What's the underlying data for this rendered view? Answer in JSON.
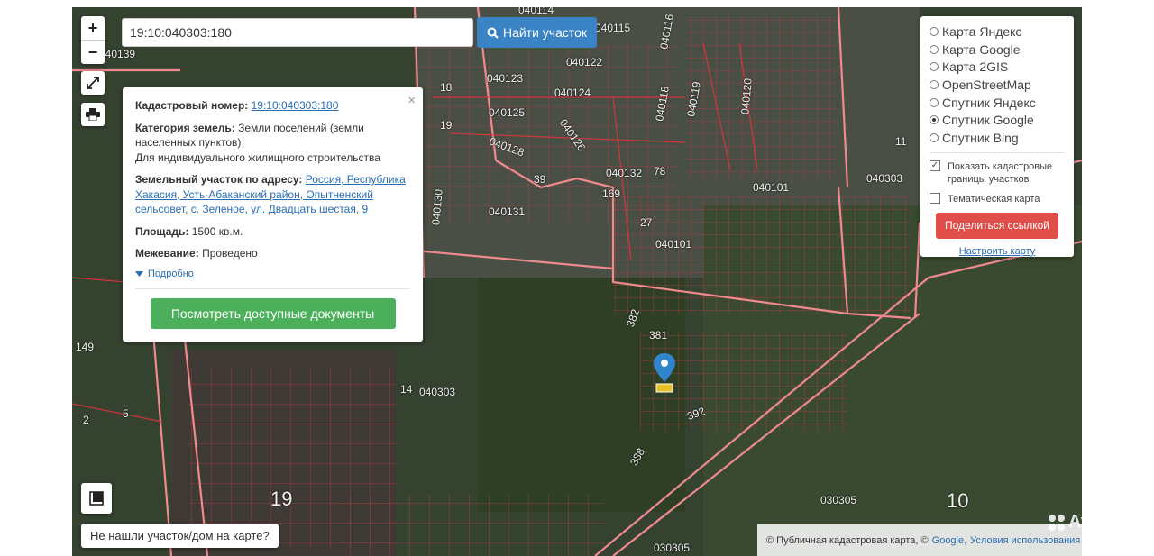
{
  "search": {
    "value": "19:10:040303:180",
    "button_label": "Найти участок"
  },
  "controls": {
    "zoom_in": "+",
    "zoom_out": "−"
  },
  "info_panel": {
    "close": "×",
    "cadastral_label": "Кадастровый номер:",
    "cadastral_value": "19:10:040303:180",
    "category_label": "Категория земель:",
    "category_value": "Земли поселений (земли населенных пунктов)",
    "usage_value": "Для индивидуального жилищного строительства",
    "address_label": "Земельный участок по адресу:",
    "address_value": "Россия, Республика Хакасия, Усть-Абаканский район, Опытненский сельсовет, с. Зеленое, ул. Двадцать шестая, 9",
    "area_label": "Площадь:",
    "area_value": "1500 кв.м.",
    "survey_label": "Межевание:",
    "survey_value": "Проведено",
    "more_link": "Подробно",
    "docs_button": "Посмотреть доступные документы"
  },
  "layers_panel": {
    "options": [
      {
        "label": "Карта Яндекс",
        "selected": false
      },
      {
        "label": "Карта Google",
        "selected": false
      },
      {
        "label": "Карта 2GIS",
        "selected": false
      },
      {
        "label": "OpenStreetMap",
        "selected": false
      },
      {
        "label": "Спутник Яндекс",
        "selected": false
      },
      {
        "label": "Спутник Google",
        "selected": true
      },
      {
        "label": "Спутник Bing",
        "selected": false
      }
    ],
    "show_borders_label": "Показать кадастровые границы участков",
    "show_borders_checked": true,
    "thematic_label": "Тематическая карта",
    "thematic_checked": false,
    "share_button": "Поделиться ссылкой",
    "setup_link": "Настроить карту"
  },
  "not_found_button": "Не нашли участок/дом на карте?",
  "attribution": {
    "text": "© Публичная кадастровая карта, ©",
    "google": "Google,",
    "terms": "Условия использования"
  },
  "map_labels": [
    "040139",
    "040114",
    "040115",
    "040116",
    "040123",
    "040122",
    "040124",
    "040118",
    "040119",
    "040120",
    "040125",
    "040126",
    "040128",
    "18",
    "19",
    "040132",
    "78",
    "39",
    "169",
    "040130",
    "040131",
    "27",
    "040101",
    "040101",
    "040303",
    "11",
    "381",
    "392",
    "14",
    "040303",
    "149",
    "2",
    "5",
    "19",
    "10",
    "030305",
    "030305",
    "388",
    "382"
  ],
  "watermark": "Avito",
  "colors": {
    "search_button": "#3a84c5",
    "docs_button": "#4caf5c",
    "share_button": "#e04e4a",
    "boundary": "#e0343d",
    "marker": "#2f86cc"
  }
}
